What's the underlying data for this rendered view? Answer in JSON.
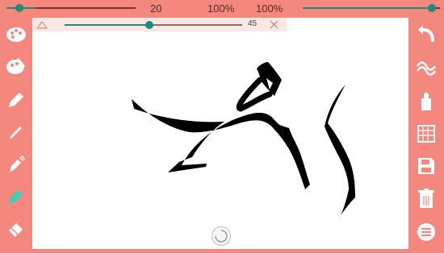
{
  "top": {
    "brush_size": "20",
    "opacity": "100%",
    "flow": "100%"
  },
  "subbar": {
    "angle": "45"
  },
  "colors": {
    "accent": "#1f8a7a",
    "background": "#f4877e",
    "canvas": "#ffffff"
  },
  "left_tools": [
    "palette-icon",
    "palette-alt-icon",
    "pencil-icon",
    "pencil-thin-icon",
    "spray-icon",
    "pen-nib-icon",
    "eraser-icon"
  ],
  "right_tools": [
    "undo-icon",
    "wave-icon",
    "bucket-icon",
    "grid-icon",
    "save-icon",
    "trash-icon",
    "menu-icon"
  ]
}
